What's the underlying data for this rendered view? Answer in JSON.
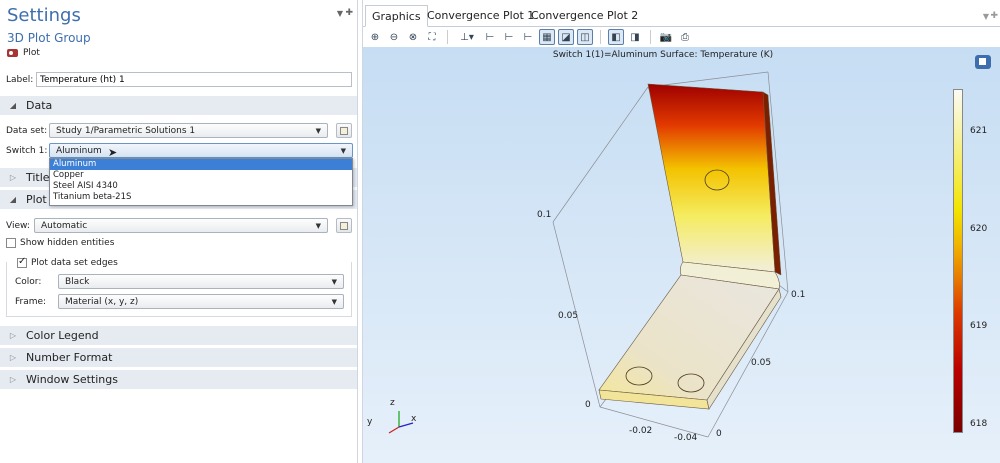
{
  "settings": {
    "title": "Settings",
    "subtitle": "3D Plot Group",
    "node_label": "Plot",
    "label_caption": "Label:",
    "label_value": "Temperature (ht) 1"
  },
  "sections": {
    "data": "Data",
    "title": "Title",
    "plot_settings": "Plot Settings",
    "color_legend": "Color Legend",
    "number_format": "Number Format",
    "window_settings": "Window Settings"
  },
  "data_section": {
    "dataset_label": "Data set:",
    "dataset_value": "Study 1/Parametric Solutions 1",
    "switch_label": "Switch 1:",
    "switch_value": "Aluminum",
    "switch_options": [
      "Aluminum",
      "Copper",
      "Steel AISI 4340",
      "Titanium beta-21S"
    ]
  },
  "plot_section": {
    "view_label": "View:",
    "view_value": "Automatic",
    "hidden_label": "Show hidden entities",
    "edges_label": "Plot data set edges",
    "color_label": "Color:",
    "color_value": "Black",
    "frame_label": "Frame:",
    "frame_value": "Material  (x, y, z)"
  },
  "tabs": [
    "Graphics",
    "Convergence Plot 1",
    "Convergence Plot 2"
  ],
  "graphics": {
    "plot_title": "Switch 1(1)=Aluminum   Surface: Temperature (K)",
    "colorbar_ticks": [
      "621",
      "620",
      "619",
      "618"
    ],
    "axis_ticks": [
      "0.1",
      "0.05",
      "0",
      "0.1",
      "0.05",
      "0",
      "-0.02",
      "-0.04"
    ],
    "triad_labels": [
      "z",
      "y",
      "x"
    ]
  },
  "colors": {
    "accent": "#3d6fae",
    "section_bg": "#e6ebf2",
    "selection": "#3c7fd6"
  }
}
